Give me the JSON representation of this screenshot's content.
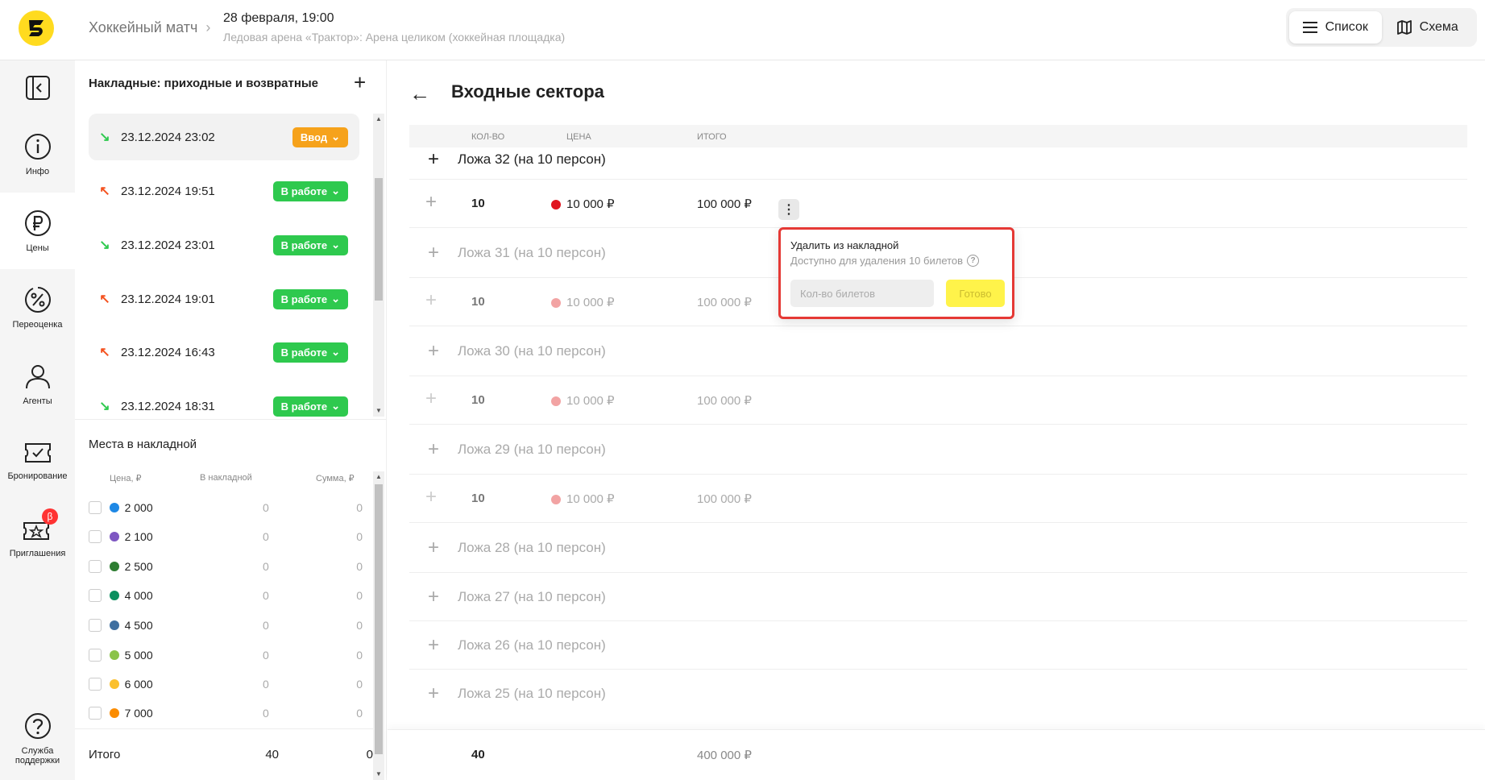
{
  "header": {
    "event_type": "Хоккейный матч",
    "event_date": "28 февраля, 19:00",
    "event_place": "Ледовая арена «Трактор»: Арена целиком (хоккейная площадка)",
    "view_list_label": "Список",
    "view_scheme_label": "Схема"
  },
  "nav": {
    "items": [
      {
        "label": "Инфо",
        "icon": "info-icon"
      },
      {
        "label": "Цены",
        "icon": "ruble-icon"
      },
      {
        "label": "Переоценка",
        "icon": "percent-icon"
      },
      {
        "label": "Агенты",
        "icon": "user-icon"
      },
      {
        "label": "Бронирование",
        "icon": "ticket-check-icon"
      },
      {
        "label": "Приглашения",
        "icon": "invite-ticket-icon",
        "badge": "β"
      },
      {
        "label": "Служба поддержки",
        "icon": "help-icon"
      }
    ]
  },
  "invoices": {
    "title": "Накладные: приходные и возвратные",
    "list": [
      {
        "type": "in",
        "datetime": "23.12.2024 23:02",
        "status": "Ввод"
      },
      {
        "type": "out",
        "datetime": "23.12.2024 19:51",
        "status": "В работе"
      },
      {
        "type": "in",
        "datetime": "23.12.2024 23:01",
        "status": "В работе"
      },
      {
        "type": "out",
        "datetime": "23.12.2024 19:01",
        "status": "В работе"
      },
      {
        "type": "out",
        "datetime": "23.12.2024 16:43",
        "status": "В работе"
      },
      {
        "type": "in",
        "datetime": "23.12.2024 18:31",
        "status": "В работе"
      }
    ]
  },
  "seats": {
    "title": "Места в накладной",
    "col_price": "Цена, ₽",
    "col_in_invoice": "В накладной",
    "col_sum": "Сумма, ₽",
    "rows": [
      {
        "price": "2 000",
        "color": "#1e88e5",
        "qty": "0",
        "sum": "0"
      },
      {
        "price": "2 100",
        "color": "#7e57c2",
        "qty": "0",
        "sum": "0"
      },
      {
        "price": "2 500",
        "color": "#2e7d32",
        "qty": "0",
        "sum": "0"
      },
      {
        "price": "4 000",
        "color": "#0a8f5f",
        "qty": "0",
        "sum": "0"
      },
      {
        "price": "4 500",
        "color": "#3f6fa0",
        "qty": "0",
        "sum": "0"
      },
      {
        "price": "5 000",
        "color": "#8bc34a",
        "qty": "0",
        "sum": "0"
      },
      {
        "price": "6 000",
        "color": "#fbc02d",
        "qty": "0",
        "sum": "0"
      },
      {
        "price": "7 000",
        "color": "#fb8c00",
        "qty": "0",
        "sum": "0"
      }
    ],
    "total_label": "Итого",
    "total_qty": "40",
    "total_sum": "0"
  },
  "main": {
    "title": "Входные сектора",
    "col_qty": "КОЛ-ВО",
    "col_price": "ЦЕНА",
    "col_total": "ИТОГО",
    "sectors": [
      {
        "name": "Ложа 32 (на 10 персон)",
        "qty": "10",
        "price": "10 000 ₽",
        "total": "100 000 ₽",
        "active": true
      },
      {
        "name": "Ложа 31 (на 10 персон)",
        "qty": "10",
        "price": "10 000 ₽",
        "total": "100 000 ₽",
        "active": false
      },
      {
        "name": "Ложа 30 (на 10 персон)",
        "qty": "10",
        "price": "10 000 ₽",
        "total": "100 000 ₽",
        "active": false
      },
      {
        "name": "Ложа 29 (на 10 персон)",
        "qty": "10",
        "price": "10 000 ₽",
        "total": "100 000 ₽",
        "active": false
      },
      {
        "name": "Ложа 28 (на 10 персон)"
      },
      {
        "name": "Ложа 27 (на 10 персон)"
      },
      {
        "name": "Ложа 26 (на 10 персон)"
      },
      {
        "name": "Ложа 25 (на 10 персон)"
      }
    ],
    "footer_qty": "40",
    "footer_total": "400 000 ₽"
  },
  "popup": {
    "title": "Удалить из накладной",
    "subtitle": "Доступно для удаления 10 билетов",
    "input_placeholder": "Кол-во билетов",
    "done_label": "Готово"
  },
  "colors": {
    "brand_yellow": "#ffdb1f",
    "status_green": "#2ec94e",
    "status_orange": "#f6a21b",
    "price_dot_red": "#e0141e",
    "highlight_red": "#e53935"
  }
}
